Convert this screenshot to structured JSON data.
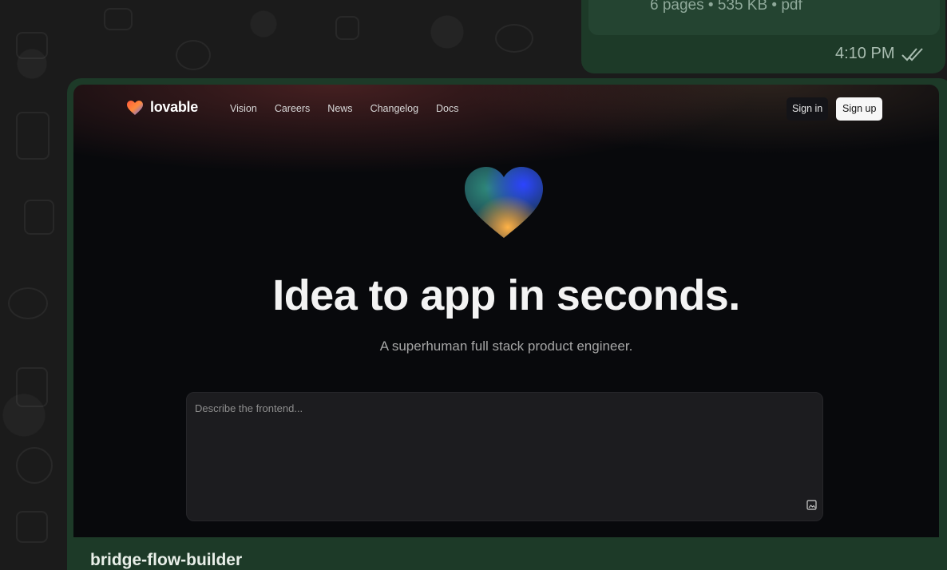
{
  "previous_message": {
    "doc_meta": "6 pages • 535 KB • pdf",
    "time": "4:10 PM",
    "status_icon": "double-check-icon"
  },
  "screenshot": {
    "brand": "lovable",
    "nav_links": [
      "Vision",
      "Careers",
      "News",
      "Changelog",
      "Docs"
    ],
    "sign_in": "Sign in",
    "sign_up": "Sign up",
    "title": "Idea to app in seconds.",
    "subtitle": "A superhuman full stack product engineer.",
    "prompt_placeholder": "Describe the frontend...",
    "attach_icon": "image-attach-icon"
  },
  "caption": "bridge-flow-builder",
  "colors": {
    "bubble": "#1d3a28",
    "background": "#171717",
    "screenshot_bg": "#08090c"
  }
}
